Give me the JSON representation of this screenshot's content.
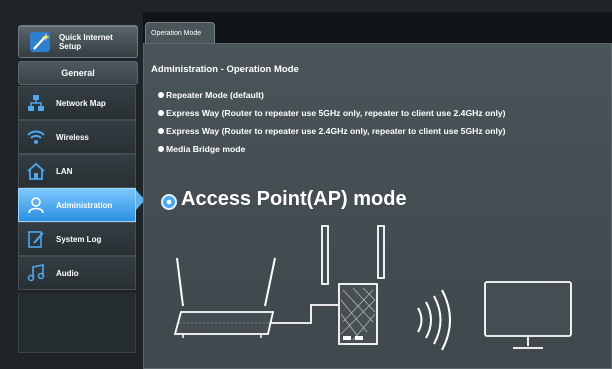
{
  "sidebar": {
    "quick_setup": "Quick Internet Setup",
    "section_header": "General",
    "items": [
      {
        "label": "Network Map",
        "icon": "network-map-icon"
      },
      {
        "label": "Wireless",
        "icon": "wireless-icon"
      },
      {
        "label": "LAN",
        "icon": "home-icon"
      },
      {
        "label": "Administration",
        "icon": "administration-icon",
        "active": true
      },
      {
        "label": "System Log",
        "icon": "system-log-icon"
      },
      {
        "label": "Audio",
        "icon": "music-note-icon"
      }
    ]
  },
  "main": {
    "tab": "Operation Mode",
    "title": "Administration - Operation Mode",
    "options": [
      "Repeater Mode (default)",
      "Express Way (Router to repeater use 5GHz only, repeater to client use 2.4GHz only)",
      "Express Way (Router to repeater use 2.4GHz only, repeater to client use 5GHz only)",
      "Media Bridge mode"
    ],
    "selected_mode": "Access Point(AP) mode"
  },
  "colors": {
    "accent": "#3d9cec",
    "panel": "#464f54",
    "background": "#1e2427"
  }
}
